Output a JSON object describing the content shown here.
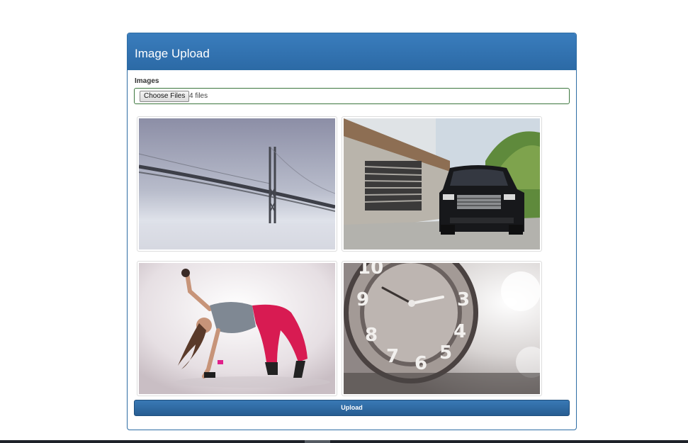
{
  "panel": {
    "title": "Image Upload"
  },
  "form": {
    "images_label": "Images",
    "choose_files_label": "Choose Files",
    "file_count_text": "4 files",
    "upload_label": "Upload"
  },
  "thumbnails": [
    {
      "subject": "foggy suspension bridge"
    },
    {
      "subject": "black luxury SUV beside building"
    },
    {
      "subject": "dancer in red pants"
    },
    {
      "subject": "close-up of clock face"
    }
  ],
  "colors": {
    "primary": "#337ab7",
    "input_border": "#3c763d"
  }
}
